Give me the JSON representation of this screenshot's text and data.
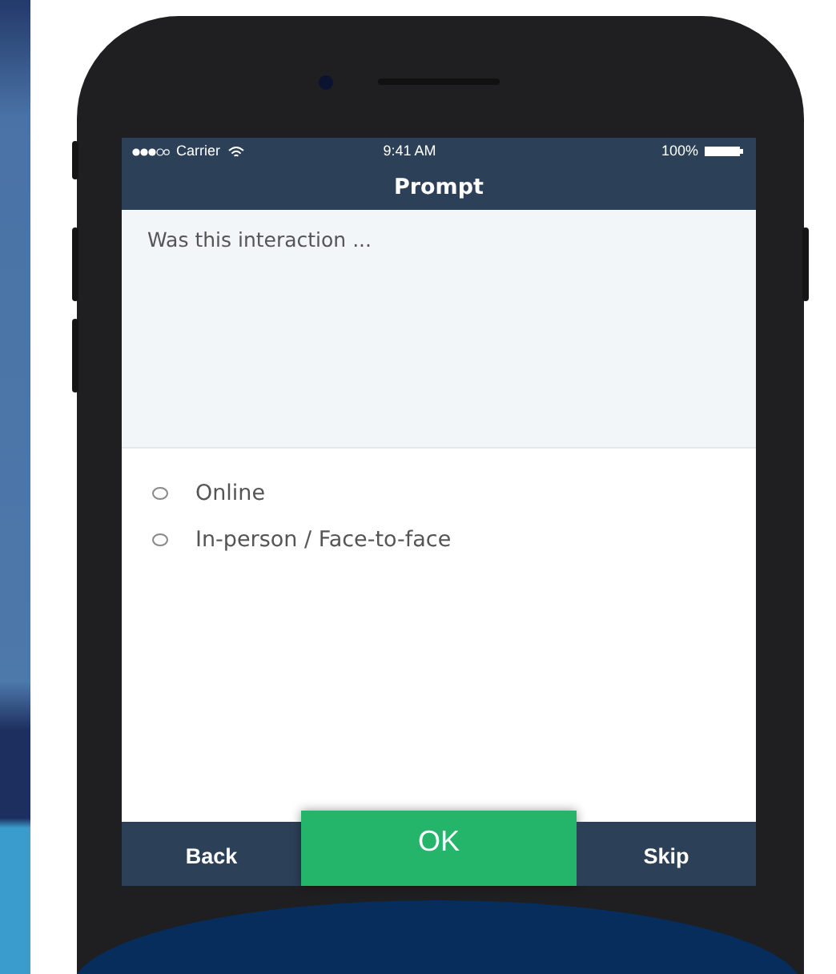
{
  "status_bar": {
    "carrier": "Carrier",
    "time": "9:41 AM",
    "battery": "100%"
  },
  "title": "Prompt",
  "prompt": "Was this interaction ...",
  "options": [
    {
      "label": "Online",
      "selected": false
    },
    {
      "label": "In-person / Face-to-face",
      "selected": false
    }
  ],
  "buttons": [
    {
      "label": "Back",
      "kind": "secondary"
    },
    {
      "label": "OK",
      "kind": "primary"
    },
    {
      "label": "Skip",
      "kind": "secondary"
    }
  ]
}
